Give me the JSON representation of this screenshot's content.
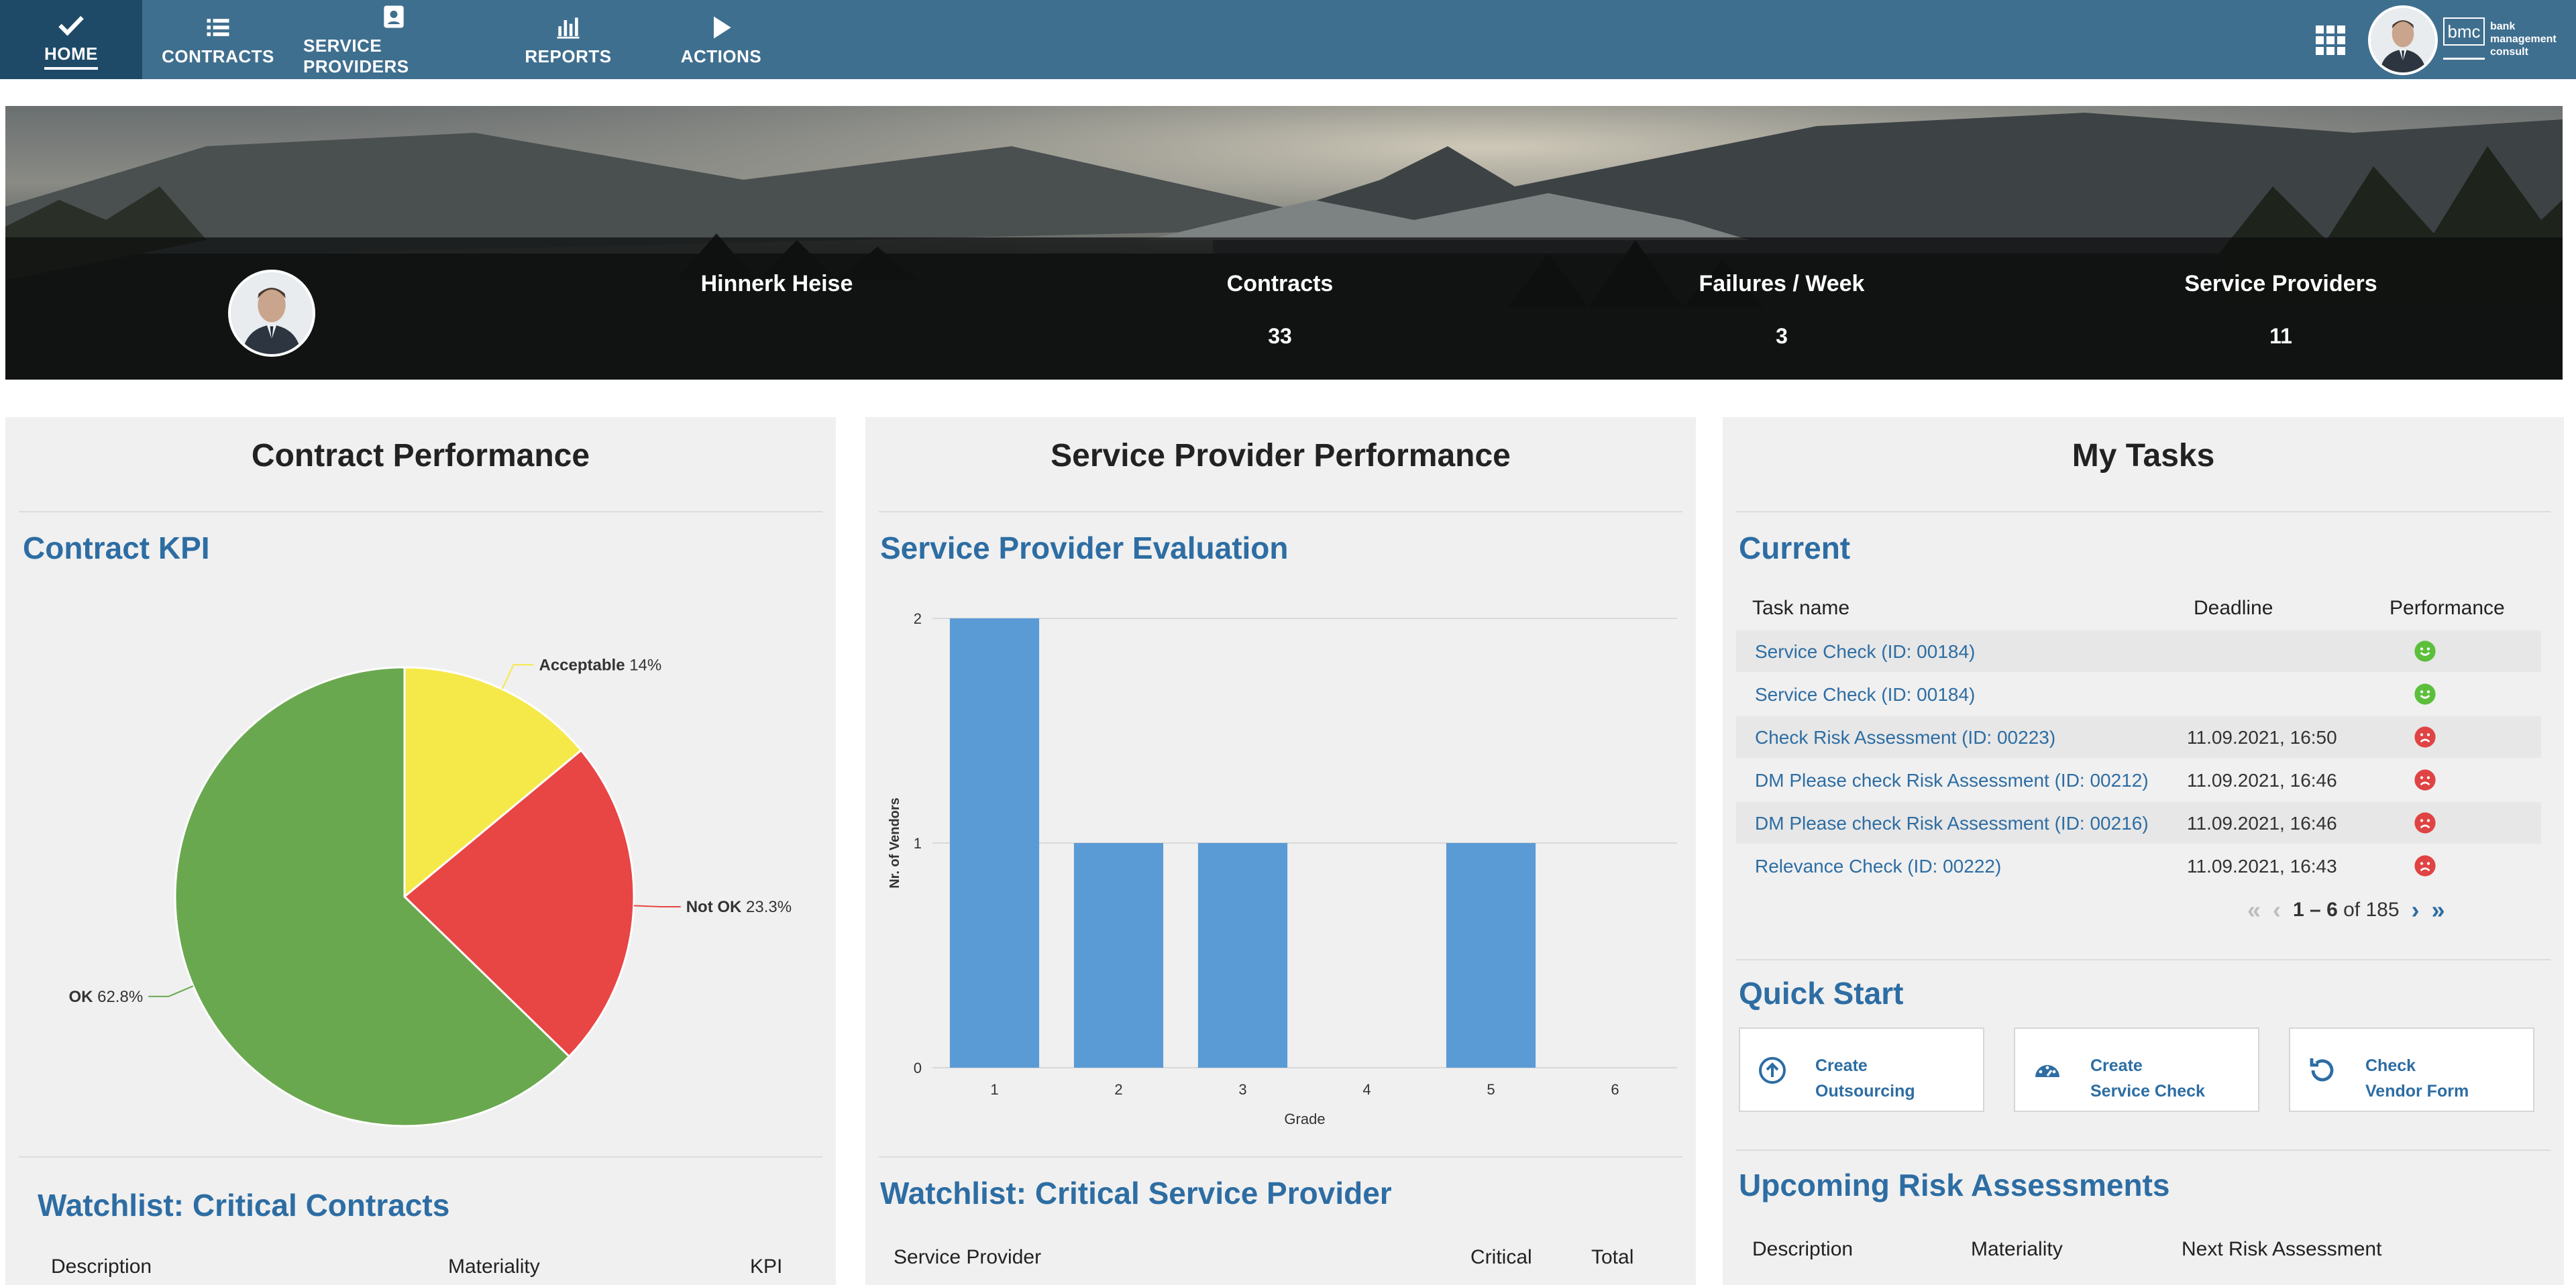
{
  "nav": {
    "items": [
      {
        "label": "HOME",
        "icon": "check-icon",
        "active": true
      },
      {
        "label": "CONTRACTS",
        "icon": "list-icon"
      },
      {
        "label": "SERVICE PROVIDERS",
        "icon": "contact-card-icon"
      },
      {
        "label": "REPORTS",
        "icon": "bar-chart-icon"
      },
      {
        "label": "ACTIONS",
        "icon": "play-icon"
      }
    ],
    "logo": {
      "mark": "bmc",
      "line1": "bank",
      "line2": "management",
      "line3": "consult"
    }
  },
  "hero": {
    "user_name": "Hinnerk Heise",
    "stats": [
      {
        "label": "Contracts",
        "value": "33"
      },
      {
        "label": "Failures / Week",
        "value": "3"
      },
      {
        "label": "Service Providers",
        "value": "11"
      }
    ]
  },
  "contract_panel": {
    "title": "Contract Performance",
    "kpi_title": "Contract KPI",
    "watchlist_title": "Watchlist: Critical Contracts",
    "columns": [
      "Description",
      "Materiality",
      "KPI"
    ]
  },
  "provider_panel": {
    "title": "Service Provider Performance",
    "eval_title": "Service Provider Evaluation",
    "watchlist_title": "Watchlist: Critical Service Provider",
    "columns": [
      "Service Provider",
      "Critical",
      "Total"
    ]
  },
  "tasks_panel": {
    "title": "My Tasks",
    "current_title": "Current",
    "columns": [
      "Task name",
      "Deadline",
      "Performance"
    ],
    "rows": [
      {
        "name": "Service Check (ID: 00184)",
        "deadline": "",
        "performance": "good"
      },
      {
        "name": "Service Check (ID: 00184)",
        "deadline": "",
        "performance": "good"
      },
      {
        "name": "Check Risk Assessment (ID: 00223)",
        "deadline": "11.09.2021, 16:50",
        "performance": "bad"
      },
      {
        "name": "DM Please check Risk Assessment (ID: 00212)",
        "deadline": "11.09.2021, 16:46",
        "performance": "bad"
      },
      {
        "name": "DM Please check Risk Assessment (ID: 00216)",
        "deadline": "11.09.2021, 16:46",
        "performance": "bad"
      },
      {
        "name": "Relevance Check (ID: 00222)",
        "deadline": "11.09.2021, 16:43",
        "performance": "bad"
      }
    ],
    "pager": {
      "range": "1 – 6",
      "of_label": "of 185"
    },
    "quick_start_title": "Quick Start",
    "quick_start": [
      {
        "line1": "Create",
        "line2": "Outsourcing",
        "icon": "upload-circle-icon"
      },
      {
        "line1": "Create",
        "line2": "Service Check",
        "icon": "gauge-icon"
      },
      {
        "line1": "Check",
        "line2": "Vendor Form",
        "icon": "refresh-icon"
      }
    ],
    "risk_title": "Upcoming Risk Assessments",
    "risk_columns": [
      "Description",
      "Materiality",
      "Next Risk Assessment"
    ]
  },
  "colors": {
    "nav": "#3f6f8f",
    "nav_active": "#1e4a68",
    "accent": "#2d6da3",
    "pie_ok": "#6aa84f",
    "pie_not_ok": "#e84545",
    "pie_acceptable": "#f5e94a",
    "bar": "#5b9bd5",
    "smile_good": "#5cbf3c",
    "smile_bad": "#e04343"
  },
  "chart_data": [
    {
      "type": "pie",
      "title": "Contract KPI",
      "slices": [
        {
          "name": "Acceptable",
          "label": "14%",
          "value": 14.0,
          "color": "#f5e94a"
        },
        {
          "name": "Not OK",
          "label": "23.3%",
          "value": 23.3,
          "color": "#e84545"
        },
        {
          "name": "OK",
          "label": "62.8%",
          "value": 62.8,
          "color": "#6aa84f"
        }
      ]
    },
    {
      "type": "bar",
      "title": "Service Provider Evaluation",
      "categories": [
        "1",
        "2",
        "3",
        "4",
        "5",
        "6"
      ],
      "values": [
        2,
        1,
        1,
        0,
        1,
        0
      ],
      "xlabel": "Grade",
      "ylabel": "Nr. of Vendors",
      "yticks": [
        "0",
        "1",
        "2"
      ],
      "ylim": [
        0,
        2
      ],
      "grid": true
    }
  ]
}
